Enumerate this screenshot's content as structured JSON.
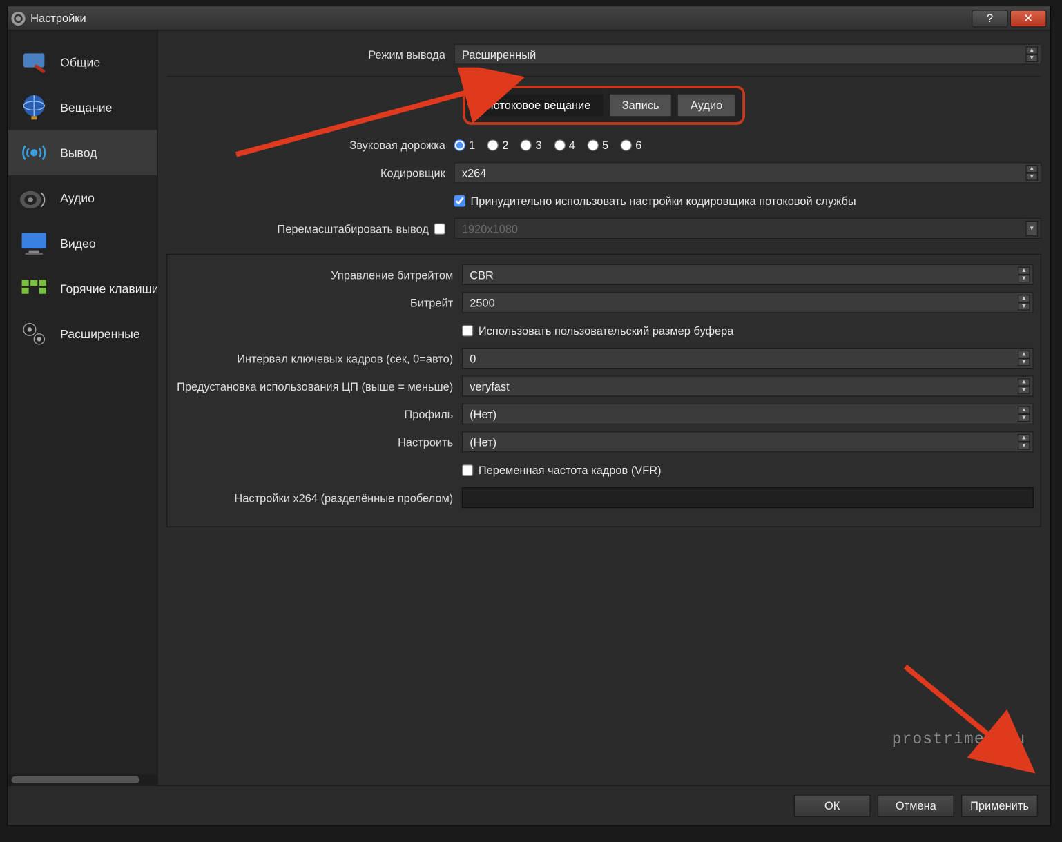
{
  "window": {
    "title": "Настройки"
  },
  "titlebar_buttons": {
    "help": "?",
    "close": "✕"
  },
  "sidebar": {
    "items": [
      {
        "label": "Общие"
      },
      {
        "label": "Вещание"
      },
      {
        "label": "Вывод"
      },
      {
        "label": "Аудио"
      },
      {
        "label": "Видео"
      },
      {
        "label": "Горячие клавиши"
      },
      {
        "label": "Расширенные"
      }
    ]
  },
  "output_mode": {
    "label": "Режим вывода",
    "value": "Расширенный"
  },
  "tabs": {
    "streaming": "Потоковое вещание",
    "recording": "Запись",
    "audio": "Аудио"
  },
  "audio_track": {
    "label": "Звуковая дорожка",
    "options": [
      "1",
      "2",
      "3",
      "4",
      "5",
      "6"
    ],
    "selected": "1"
  },
  "encoder": {
    "label": "Кодировщик",
    "value": "x264"
  },
  "enforce": {
    "label": "Принудительно использовать настройки кодировщика потоковой службы",
    "checked": true
  },
  "rescale": {
    "label": "Перемасштабировать вывод",
    "checked": false,
    "value": "1920x1080"
  },
  "rate_control": {
    "label": "Управление битрейтом",
    "value": "CBR"
  },
  "bitrate": {
    "label": "Битрейт",
    "value": "2500"
  },
  "custom_buffer": {
    "label": "Использовать пользовательский размер буфера",
    "checked": false
  },
  "keyframe": {
    "label": "Интервал ключевых кадров (сек, 0=авто)",
    "value": "0"
  },
  "cpu_preset": {
    "label": "Предустановка использования ЦП (выше = меньше)",
    "value": "veryfast"
  },
  "profile": {
    "label": "Профиль",
    "value": "(Нет)"
  },
  "tune": {
    "label": "Настроить",
    "value": "(Нет)"
  },
  "vfr": {
    "label": "Переменная частота кадров (VFR)",
    "checked": false
  },
  "x264opts": {
    "label": "Настройки x264 (разделённые пробелом)",
    "value": ""
  },
  "footer": {
    "ok": "ОК",
    "cancel": "Отмена",
    "apply": "Применить"
  },
  "watermark": "prostrimer.ru"
}
